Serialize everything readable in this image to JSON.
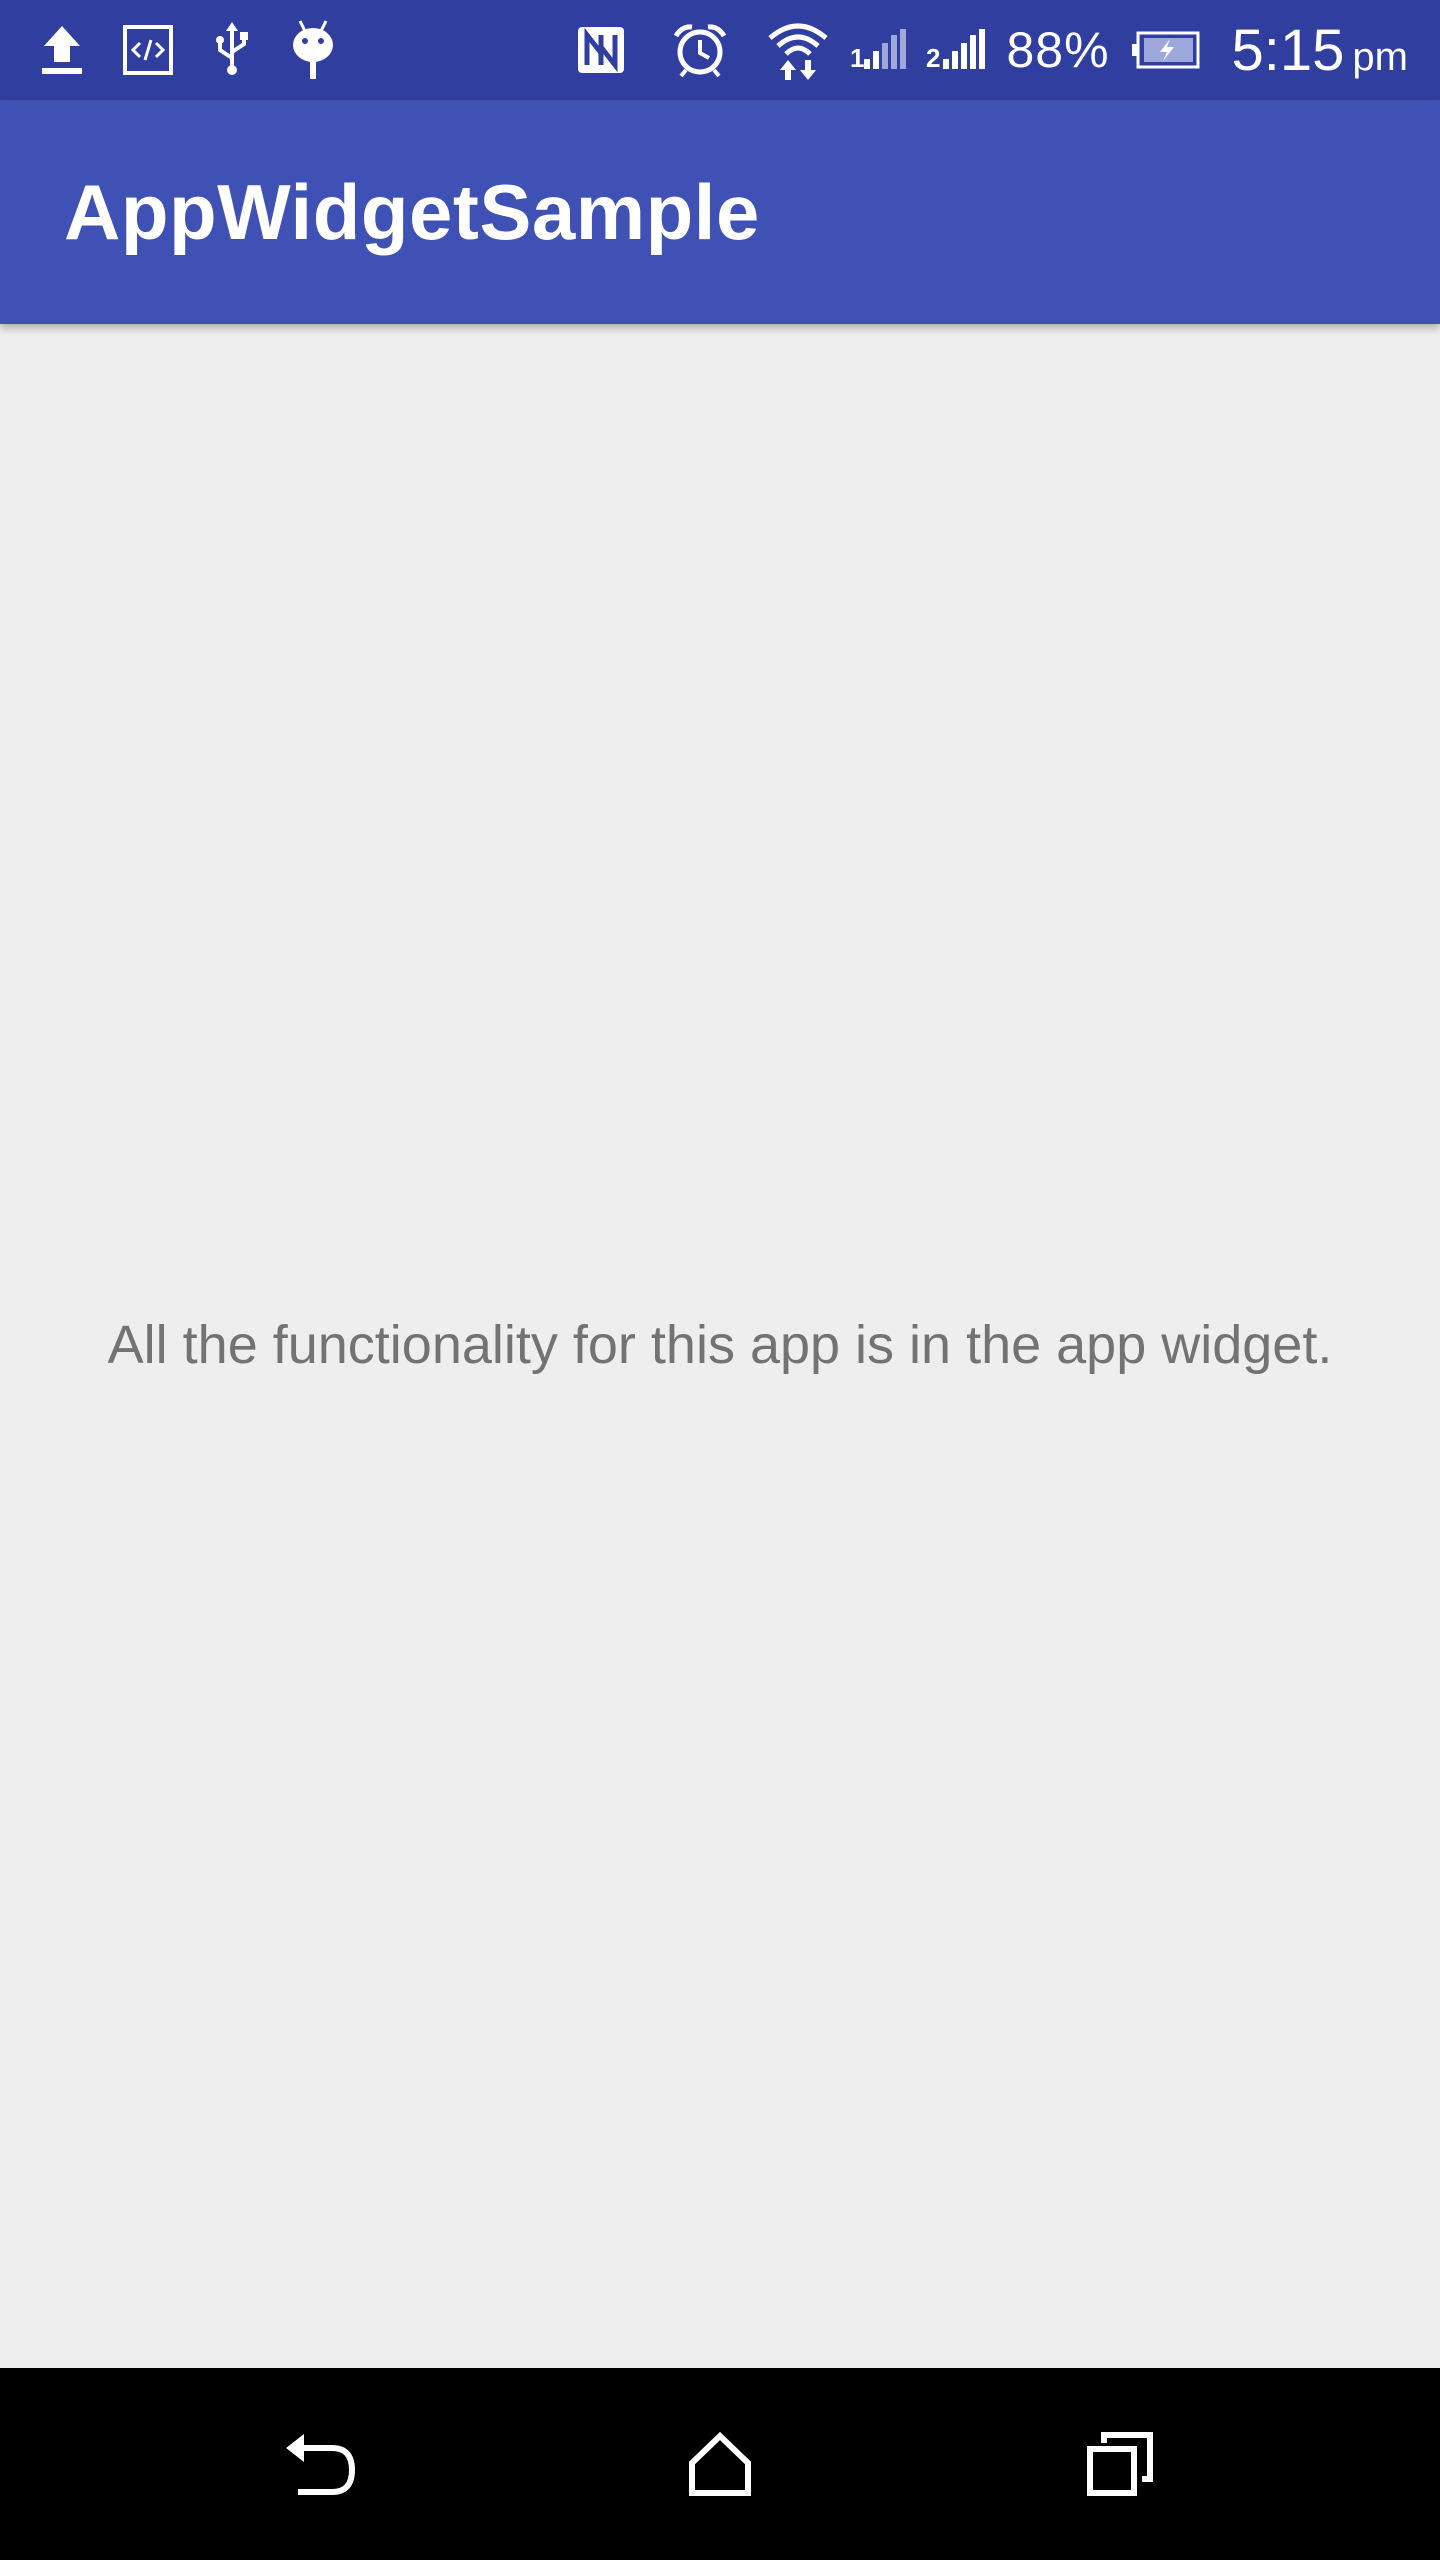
{
  "status_bar": {
    "icons_left": [
      "upload-icon",
      "code-icon",
      "usb-icon",
      "android-debug-icon"
    ],
    "icons_right": [
      "nfc-icon",
      "alarm-icon",
      "wifi-icon",
      "signal-sim1-icon",
      "signal-sim2-icon",
      "battery-charging-icon"
    ],
    "battery_percent": "88%",
    "time": "5:15",
    "ampm": "pm"
  },
  "app_bar": {
    "title": "AppWidgetSample"
  },
  "main": {
    "message": "All the functionality for this app is in the app widget."
  },
  "nav_bar": {
    "buttons": [
      "back-icon",
      "home-icon",
      "recents-icon"
    ]
  },
  "colors": {
    "status_bar": "#303f9f",
    "app_bar": "#3f51b5",
    "background": "#eeeeee",
    "message_text": "#737373",
    "nav_bar": "#000000"
  }
}
